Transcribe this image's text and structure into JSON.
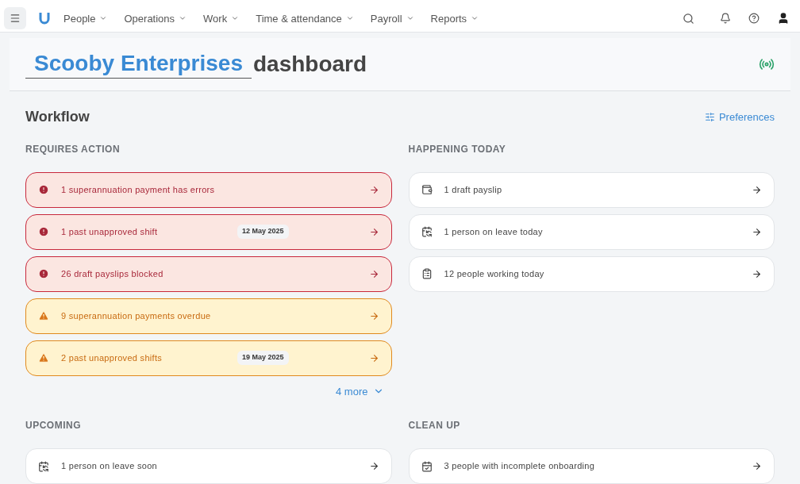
{
  "nav": {
    "items": [
      {
        "label": "People"
      },
      {
        "label": "Operations"
      },
      {
        "label": "Work"
      },
      {
        "label": "Time & attendance"
      },
      {
        "label": "Payroll"
      },
      {
        "label": "Reports"
      }
    ]
  },
  "header": {
    "company": "Scooby Enterprises",
    "title": "dashboard"
  },
  "workflow": {
    "title": "Workflow",
    "preferences": "Preferences",
    "sections": [
      {
        "title": "REQUIRES ACTION",
        "more": "4 more",
        "items": [
          {
            "kind": "error",
            "text": "1 superannuation payment has errors"
          },
          {
            "kind": "error",
            "text": "1 past unapproved shift",
            "date": "12 May 2025"
          },
          {
            "kind": "error",
            "text": "26 draft payslips blocked"
          },
          {
            "kind": "warning",
            "text": "9 superannuation payments overdue"
          },
          {
            "kind": "warning",
            "text": "2 past unapproved shifts",
            "date": "19 May 2025"
          }
        ]
      },
      {
        "title": "HAPPENING TODAY",
        "items": [
          {
            "kind": "payslip",
            "text": "1 draft payslip"
          },
          {
            "kind": "leave",
            "text": "1 person on leave today"
          },
          {
            "kind": "roster",
            "text": "12 people working today"
          }
        ]
      },
      {
        "title": "UPCOMING",
        "items": [
          {
            "kind": "leave",
            "text": "1 person on leave soon"
          }
        ]
      },
      {
        "title": "CLEAN UP",
        "items": [
          {
            "kind": "onboarding",
            "text": "3 people with incomplete onboarding"
          }
        ]
      }
    ]
  }
}
